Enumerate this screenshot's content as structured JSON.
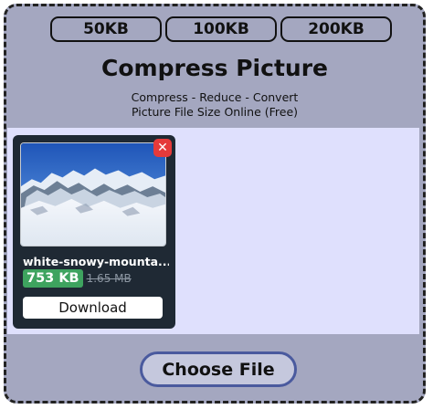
{
  "presets": [
    "50KB",
    "100KB",
    "200KB"
  ],
  "title": "Compress Picture",
  "subtitle": {
    "line1": "Compress - Reduce - Convert",
    "line2": "Picture File Size Online (Free)"
  },
  "file": {
    "name": "white-snowy-mounta...",
    "compressed_size": "753 KB",
    "original_size": "1.65 MB",
    "remove_icon": "close-icon",
    "download_label": "Download",
    "size_badge_color": "#3ea35f"
  },
  "choose_file_label": "Choose File",
  "colors": {
    "panel": "#a4a7c0",
    "dropzone": "#dfe0fd",
    "card": "#1f2934",
    "close": "#e53a3a",
    "accent_border": "#4a5a9e"
  }
}
